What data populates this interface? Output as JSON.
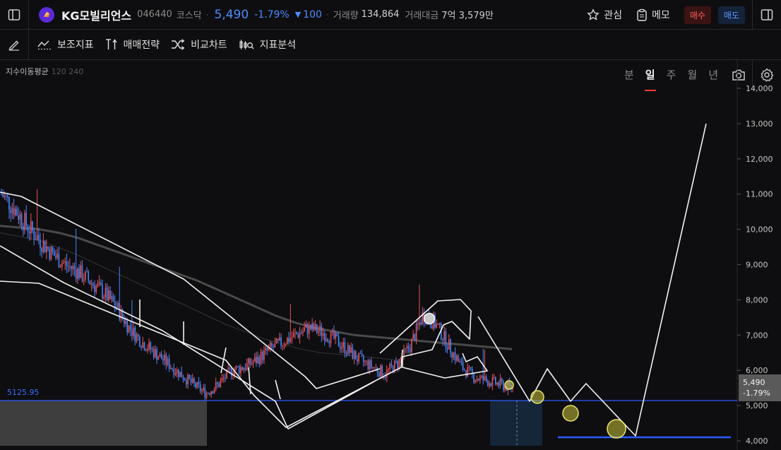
{
  "header": {
    "stock_name": "KG모빌리언스",
    "stock_code": "046440",
    "market": "코스닥",
    "price": "5,490",
    "change_pct": "-1.79%",
    "change_arrow": "▼",
    "change_value": "100",
    "volume_label": "거래량",
    "volume_value": "134,864",
    "amount_label": "거래대금",
    "amount_value": "7억 3,579만",
    "watch_label": "관심",
    "memo_label": "메모",
    "buy_label": "매수",
    "sell_label": "매도"
  },
  "toolbar": {
    "tools": [
      {
        "label": "보조지표"
      },
      {
        "label": "매매전략"
      },
      {
        "label": "비교차트"
      },
      {
        "label": "지표분석"
      }
    ],
    "periods": [
      "분",
      "일",
      "주",
      "월",
      "년"
    ],
    "active_period": "일"
  },
  "chart": {
    "indicator_label": "지수이동평균",
    "indicator_params": "120 240",
    "price_label": "5125.95",
    "current_price": "5,490",
    "current_change": "-1.79%",
    "y_ticks": [
      "14,000",
      "13,000",
      "12,000",
      "11,000",
      "10,000",
      "9,000",
      "8,000",
      "7,000",
      "6,000",
      "5,000",
      "4,000"
    ]
  },
  "chart_data": {
    "type": "line",
    "ylim": [
      3900,
      14400
    ],
    "y_ticks": [
      14000,
      13000,
      12000,
      11000,
      10000,
      9000,
      8000,
      7000,
      6000,
      5000,
      4000
    ],
    "horizontal_line": 5125.95,
    "last_price": 5490,
    "last_change": "-1.79%",
    "price_path": [
      11000,
      10600,
      10100,
      9700,
      9300,
      9000,
      8800,
      8500,
      8200,
      7800,
      7200,
      6800,
      6500,
      6200,
      5900,
      5600,
      5350,
      5600,
      6000,
      6100,
      6300,
      6600,
      6800,
      7000,
      7200,
      7100,
      6900,
      6600,
      6300,
      6100,
      5900,
      6200,
      6700,
      7600,
      7300,
      6700,
      6100,
      5800,
      5700,
      5600,
      5490
    ],
    "ema_120": [
      10100,
      10050,
      10000,
      9900,
      9750,
      9550,
      9350,
      9150,
      8950,
      8750,
      8550,
      8300,
      8050,
      7800,
      7550,
      7350,
      7200,
      7100,
      7000,
      6950,
      6900,
      6850,
      6800,
      6750,
      6700,
      6650,
      6600
    ],
    "ema_240": [
      9900,
      9800,
      9700,
      9500,
      9300,
      9050,
      8800,
      8550,
      8300,
      8050,
      7800,
      7550,
      7300,
      7100,
      6900,
      6750,
      6600,
      6500,
      6450,
      6400,
      6350,
      6300
    ]
  }
}
